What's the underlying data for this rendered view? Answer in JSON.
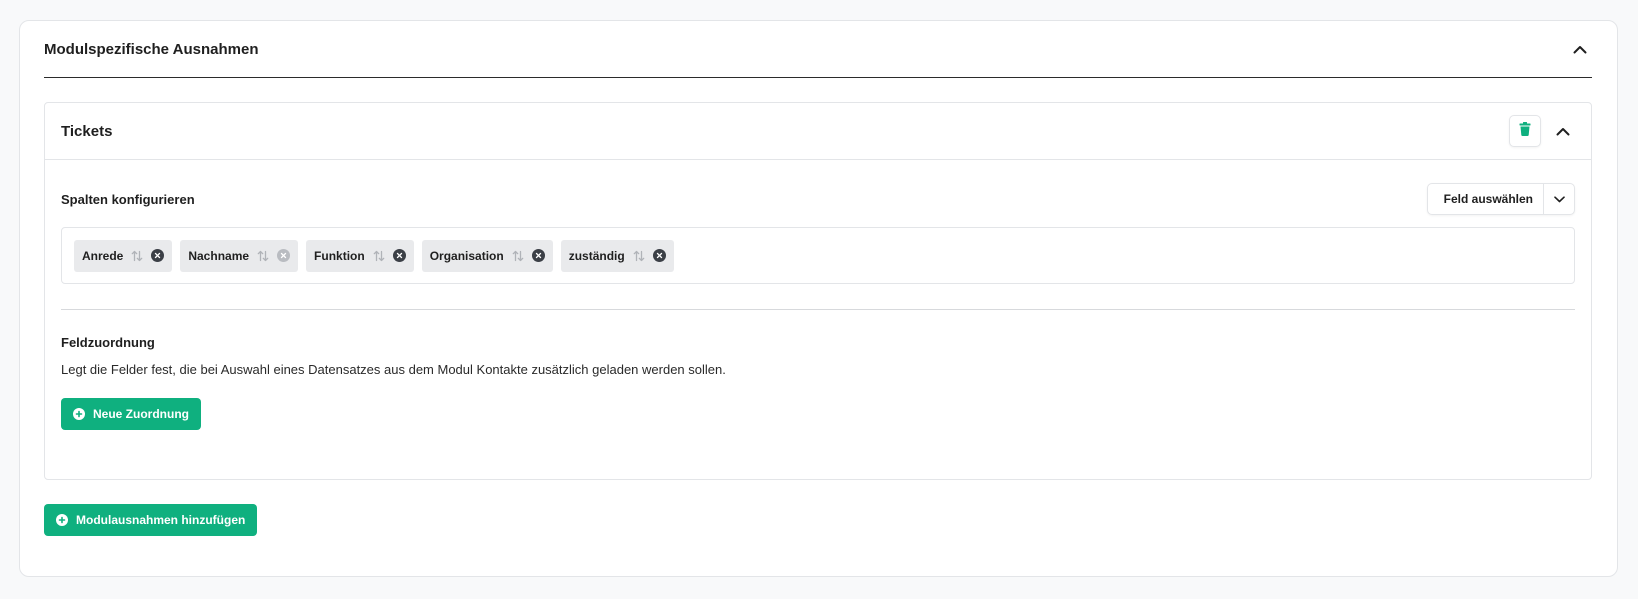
{
  "section": {
    "title": "Modulspezifische Ausnahmen",
    "collapse_icon": "chevron-up-icon"
  },
  "module_card": {
    "title": "Tickets",
    "delete_icon": "trash-icon",
    "collapse_icon": "chevron-up-icon",
    "columns": {
      "heading": "Spalten konfigurieren",
      "select_field_label": "Feld auswählen",
      "select_field_icon": "chevron-down-icon",
      "tags": [
        {
          "label": "Anrede",
          "remove_disabled": false
        },
        {
          "label": "Nachname",
          "remove_disabled": true
        },
        {
          "label": "Funktion",
          "remove_disabled": false
        },
        {
          "label": "Organisation",
          "remove_disabled": false
        },
        {
          "label": "zuständig",
          "remove_disabled": false
        }
      ]
    },
    "mapping": {
      "heading": "Feldzuordnung",
      "description": "Legt die Felder fest, die bei Auswahl eines Datensatzes aus dem Modul Kontakte zusätzlich geladen werden sollen.",
      "new_button_label": "Neue Zuordnung"
    }
  },
  "add_module_button_label": "Modulausnahmen hinzufügen",
  "colors": {
    "accent": "#0fb07f",
    "trash": "#0fb07f",
    "tag_bg": "#e9eaec"
  }
}
